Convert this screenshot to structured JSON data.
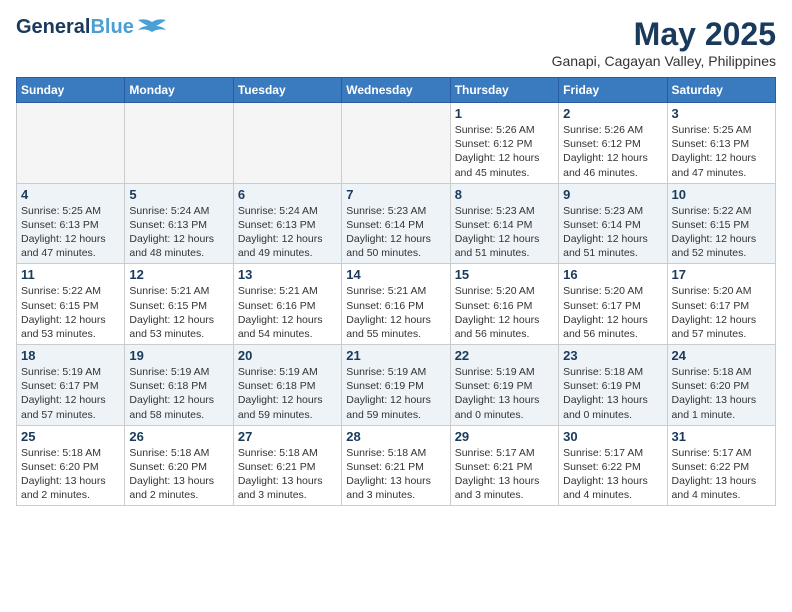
{
  "logo": {
    "general": "General",
    "blue": "Blue"
  },
  "title": "May 2025",
  "location": "Ganapi, Cagayan Valley, Philippines",
  "weekdays": [
    "Sunday",
    "Monday",
    "Tuesday",
    "Wednesday",
    "Thursday",
    "Friday",
    "Saturday"
  ],
  "weeks": [
    [
      {
        "day": "",
        "info": ""
      },
      {
        "day": "",
        "info": ""
      },
      {
        "day": "",
        "info": ""
      },
      {
        "day": "",
        "info": ""
      },
      {
        "day": "1",
        "info": "Sunrise: 5:26 AM\nSunset: 6:12 PM\nDaylight: 12 hours\nand 45 minutes."
      },
      {
        "day": "2",
        "info": "Sunrise: 5:26 AM\nSunset: 6:12 PM\nDaylight: 12 hours\nand 46 minutes."
      },
      {
        "day": "3",
        "info": "Sunrise: 5:25 AM\nSunset: 6:13 PM\nDaylight: 12 hours\nand 47 minutes."
      }
    ],
    [
      {
        "day": "4",
        "info": "Sunrise: 5:25 AM\nSunset: 6:13 PM\nDaylight: 12 hours\nand 47 minutes."
      },
      {
        "day": "5",
        "info": "Sunrise: 5:24 AM\nSunset: 6:13 PM\nDaylight: 12 hours\nand 48 minutes."
      },
      {
        "day": "6",
        "info": "Sunrise: 5:24 AM\nSunset: 6:13 PM\nDaylight: 12 hours\nand 49 minutes."
      },
      {
        "day": "7",
        "info": "Sunrise: 5:23 AM\nSunset: 6:14 PM\nDaylight: 12 hours\nand 50 minutes."
      },
      {
        "day": "8",
        "info": "Sunrise: 5:23 AM\nSunset: 6:14 PM\nDaylight: 12 hours\nand 51 minutes."
      },
      {
        "day": "9",
        "info": "Sunrise: 5:23 AM\nSunset: 6:14 PM\nDaylight: 12 hours\nand 51 minutes."
      },
      {
        "day": "10",
        "info": "Sunrise: 5:22 AM\nSunset: 6:15 PM\nDaylight: 12 hours\nand 52 minutes."
      }
    ],
    [
      {
        "day": "11",
        "info": "Sunrise: 5:22 AM\nSunset: 6:15 PM\nDaylight: 12 hours\nand 53 minutes."
      },
      {
        "day": "12",
        "info": "Sunrise: 5:21 AM\nSunset: 6:15 PM\nDaylight: 12 hours\nand 53 minutes."
      },
      {
        "day": "13",
        "info": "Sunrise: 5:21 AM\nSunset: 6:16 PM\nDaylight: 12 hours\nand 54 minutes."
      },
      {
        "day": "14",
        "info": "Sunrise: 5:21 AM\nSunset: 6:16 PM\nDaylight: 12 hours\nand 55 minutes."
      },
      {
        "day": "15",
        "info": "Sunrise: 5:20 AM\nSunset: 6:16 PM\nDaylight: 12 hours\nand 56 minutes."
      },
      {
        "day": "16",
        "info": "Sunrise: 5:20 AM\nSunset: 6:17 PM\nDaylight: 12 hours\nand 56 minutes."
      },
      {
        "day": "17",
        "info": "Sunrise: 5:20 AM\nSunset: 6:17 PM\nDaylight: 12 hours\nand 57 minutes."
      }
    ],
    [
      {
        "day": "18",
        "info": "Sunrise: 5:19 AM\nSunset: 6:17 PM\nDaylight: 12 hours\nand 57 minutes."
      },
      {
        "day": "19",
        "info": "Sunrise: 5:19 AM\nSunset: 6:18 PM\nDaylight: 12 hours\nand 58 minutes."
      },
      {
        "day": "20",
        "info": "Sunrise: 5:19 AM\nSunset: 6:18 PM\nDaylight: 12 hours\nand 59 minutes."
      },
      {
        "day": "21",
        "info": "Sunrise: 5:19 AM\nSunset: 6:19 PM\nDaylight: 12 hours\nand 59 minutes."
      },
      {
        "day": "22",
        "info": "Sunrise: 5:19 AM\nSunset: 6:19 PM\nDaylight: 13 hours\nand 0 minutes."
      },
      {
        "day": "23",
        "info": "Sunrise: 5:18 AM\nSunset: 6:19 PM\nDaylight: 13 hours\nand 0 minutes."
      },
      {
        "day": "24",
        "info": "Sunrise: 5:18 AM\nSunset: 6:20 PM\nDaylight: 13 hours\nand 1 minute."
      }
    ],
    [
      {
        "day": "25",
        "info": "Sunrise: 5:18 AM\nSunset: 6:20 PM\nDaylight: 13 hours\nand 2 minutes."
      },
      {
        "day": "26",
        "info": "Sunrise: 5:18 AM\nSunset: 6:20 PM\nDaylight: 13 hours\nand 2 minutes."
      },
      {
        "day": "27",
        "info": "Sunrise: 5:18 AM\nSunset: 6:21 PM\nDaylight: 13 hours\nand 3 minutes."
      },
      {
        "day": "28",
        "info": "Sunrise: 5:18 AM\nSunset: 6:21 PM\nDaylight: 13 hours\nand 3 minutes."
      },
      {
        "day": "29",
        "info": "Sunrise: 5:17 AM\nSunset: 6:21 PM\nDaylight: 13 hours\nand 3 minutes."
      },
      {
        "day": "30",
        "info": "Sunrise: 5:17 AM\nSunset: 6:22 PM\nDaylight: 13 hours\nand 4 minutes."
      },
      {
        "day": "31",
        "info": "Sunrise: 5:17 AM\nSunset: 6:22 PM\nDaylight: 13 hours\nand 4 minutes."
      }
    ]
  ]
}
